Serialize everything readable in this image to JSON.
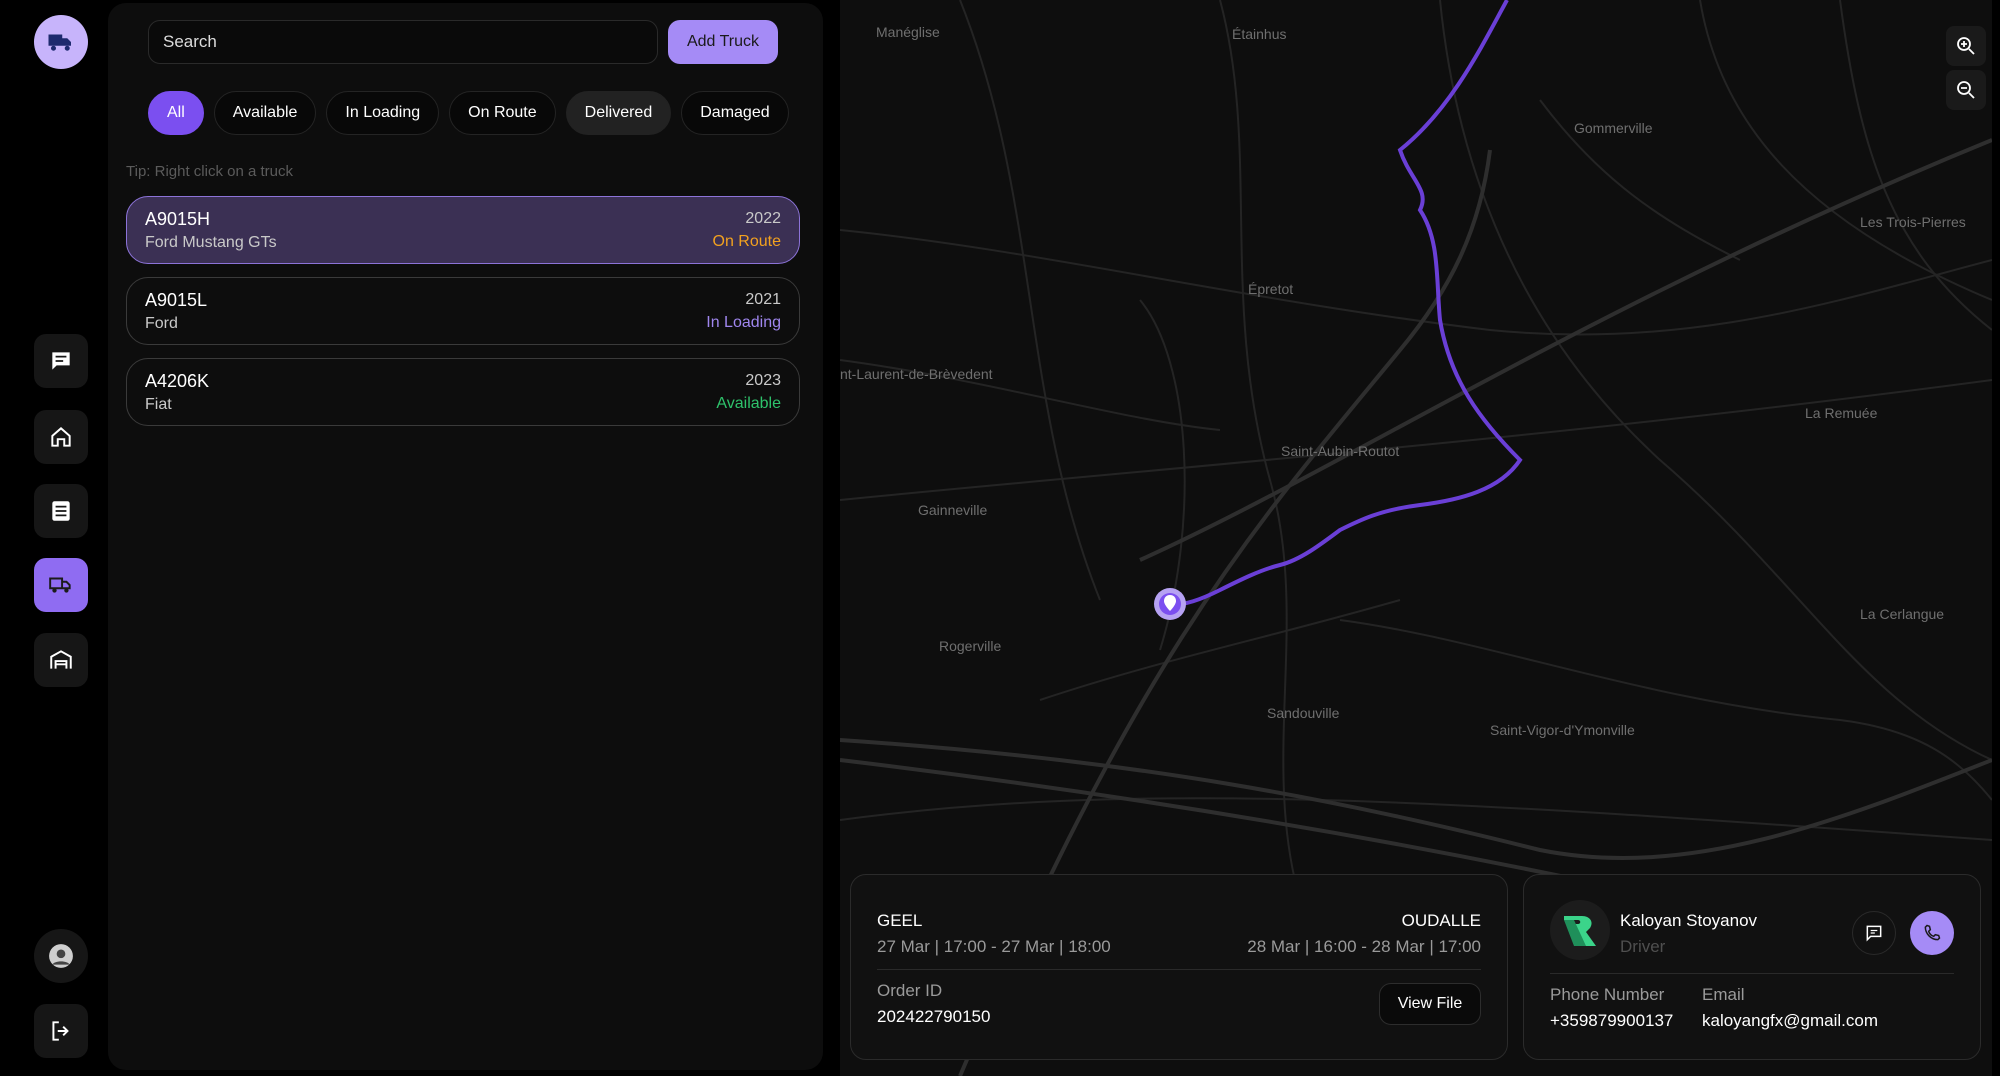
{
  "search": {
    "placeholder": "Search"
  },
  "toolbar": {
    "add_truck_label": "Add Truck"
  },
  "filters": [
    {
      "label": "All",
      "active": true
    },
    {
      "label": "Available"
    },
    {
      "label": "In Loading"
    },
    {
      "label": "On Route"
    },
    {
      "label": "Delivered"
    },
    {
      "label": "Damaged"
    }
  ],
  "tip": "Tip: Right click on a truck",
  "trucks": [
    {
      "plate": "A9015H",
      "model": "Ford Mustang GTs",
      "year": "2022",
      "status": "On Route",
      "status_color": "#f2a11f",
      "selected": true
    },
    {
      "plate": "A9015L",
      "model": "Ford",
      "year": "2021",
      "status": "In Loading",
      "status_color": "#9f86ee"
    },
    {
      "plate": "A4206K",
      "model": "Fiat",
      "year": "2023",
      "status": "Available",
      "status_color": "#2ec26b"
    }
  ],
  "map": {
    "labels": [
      "Manéglise",
      "Étainhus",
      "Gommerville",
      "Les Trois-Pierres",
      "Épretot",
      "nt-Laurent-de-Brèvedent",
      "La Remuée",
      "Saint-Aubin-Routot",
      "Gainneville",
      "Rogerville",
      "Sandouville",
      "Saint-Vigor-d'Ymonville",
      "La Cerlangue"
    ],
    "route_color": "#6a3fd6"
  },
  "trip": {
    "from_city": "GEEL",
    "from_time": "27 Mar | 17:00 - 27 Mar | 18:00",
    "to_city": "OUDALLE",
    "to_time": "28 Mar | 16:00 - 28 Mar | 17:00",
    "order_label": "Order ID",
    "order_id": "202422790150",
    "view_file_label": "View File"
  },
  "driver": {
    "name": "Kaloyan Stoyanov",
    "role": "Driver",
    "phone_label": "Phone Number",
    "phone": "+359879900137",
    "email_label": "Email",
    "email": "kaloyangfx@gmail.com"
  },
  "colors": {
    "accent": "#a58bf6",
    "accent_strong": "#7b4ff0",
    "on_route": "#f2a11f",
    "in_loading": "#9f86ee",
    "available": "#2ec26b"
  },
  "icons": {
    "logo": "truck-icon",
    "rail": [
      "chat-icon",
      "home-icon",
      "list-icon",
      "truck-icon",
      "warehouse-icon",
      "avatar",
      "logout-icon"
    ],
    "zoom": [
      "zoom-in-icon",
      "zoom-out-icon"
    ]
  }
}
